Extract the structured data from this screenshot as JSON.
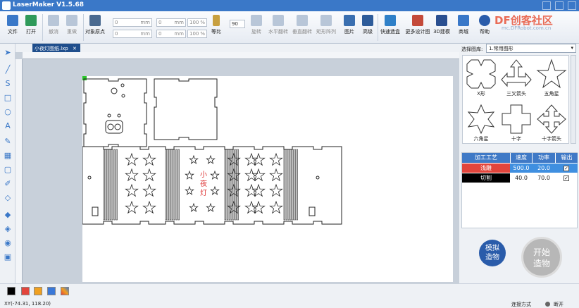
{
  "window": {
    "title": "LaserMaker V1.5.68"
  },
  "toolbar": {
    "file": "文件",
    "open": "打开",
    "undo": "撤消",
    "redo": "重做",
    "align": "对象原点",
    "x": "0",
    "y": "0",
    "w": "0",
    "h": "0",
    "unit_mm": "mm",
    "pct": "100",
    "pct_sign": "%",
    "lock": "等比",
    "rotate_value": "90",
    "rotate": "旋转",
    "hflip": "水平翻转",
    "vflip": "垂直翻转",
    "array": "矩形阵列",
    "image": "图片",
    "advanced": "高级",
    "quick_box": "快速造盒",
    "more_design": "更多设计图",
    "model3d": "3D建模",
    "store": "商城",
    "help": "帮助"
  },
  "watermark": {
    "text": "DF创客社区",
    "sub": "mc.DFRobot.com.cn"
  },
  "tab": {
    "label": "小夜灯图纸.lxp",
    "close": "✕"
  },
  "design": {
    "text_chars": [
      "小",
      "夜",
      "灯"
    ]
  },
  "library": {
    "label": "选择图库:",
    "selected": "1.常用图形",
    "shapes": [
      {
        "name": "X形",
        "icon": "x-shape-icon"
      },
      {
        "name": "三叉箭头",
        "icon": "tri-arrow-icon"
      },
      {
        "name": "五角星",
        "icon": "star5-icon"
      },
      {
        "name": "六角星",
        "icon": "star6-icon"
      },
      {
        "name": "十字",
        "icon": "cross-icon"
      },
      {
        "name": "十字箭头",
        "icon": "cross-arrow-icon"
      }
    ]
  },
  "process": {
    "headers": [
      "加工工艺",
      "速度",
      "功率",
      "输出"
    ],
    "rows": [
      {
        "name": "浅雕",
        "speed": "500.0",
        "power": "20.0",
        "output": true,
        "color": "#e2453c"
      },
      {
        "name": "切割",
        "speed": "40.0",
        "power": "70.0",
        "output": true,
        "color": "#000000"
      }
    ]
  },
  "buttons": {
    "simulate": "模拟造物",
    "start": "开始造物"
  },
  "status": {
    "coords": "XY(-74.31, 118.20)",
    "connection_label": "连接方式",
    "device": "断开",
    "swatches": [
      "#000000",
      "#e2453c",
      "#f0a020",
      "#3a78d8",
      "#c84fb0"
    ]
  }
}
